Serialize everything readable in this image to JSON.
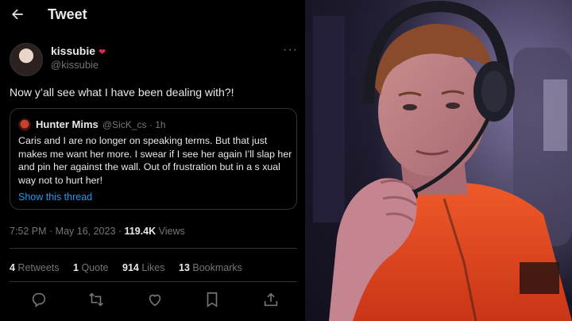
{
  "header": {
    "title": "Tweet"
  },
  "author": {
    "name": "kissubie",
    "handle": "@kissubie"
  },
  "tweet": {
    "text": "Now y’all see what I have been dealing with?!"
  },
  "quote": {
    "name": "Hunter Mims",
    "handle": "@SicK_cs · 1h",
    "text": "Caris and I are no longer on speaking terms. But that just makes me want her more. I swear if I see her again I’ll slap her and pin her against the wall. Out of frustration but in a s xual way not to hurt her!",
    "link": "Show this thread"
  },
  "meta": {
    "time": "7:52 PM · May 16, 2023 · ",
    "views_count": "119.4K",
    "views_label": " Views"
  },
  "stats": {
    "retweets_count": "4",
    "retweets_label": " Retweets",
    "quotes_count": "1",
    "quotes_label": " Quote",
    "likes_count": "914",
    "likes_label": " Likes",
    "bookmarks_count": "13",
    "bookmarks_label": " Bookmarks"
  },
  "colors": {
    "accent": "#1d9bf0",
    "heart": "#e0245e",
    "jersey": "#e8401c"
  },
  "icons": [
    "back-arrow-icon",
    "heart-emoji-icon",
    "more-icon",
    "reply-icon",
    "retweet-icon",
    "like-icon",
    "bookmark-icon",
    "share-icon"
  ]
}
